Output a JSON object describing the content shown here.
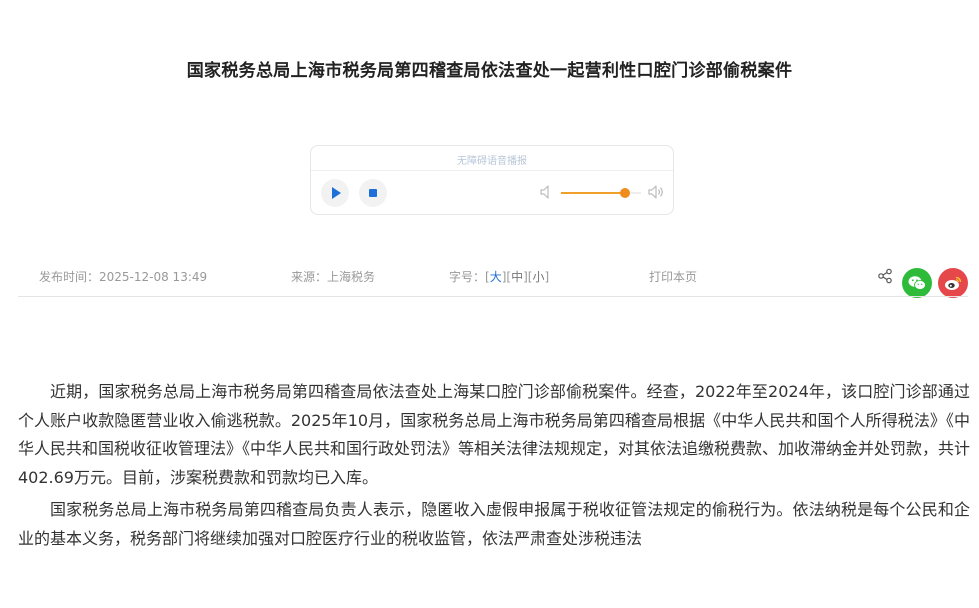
{
  "article": {
    "title": "国家税务总局上海市税务局第四稽查局依法查处一起营利性口腔门诊部偷税案件",
    "paragraphs": [
      "近期，国家税务总局上海市税务局第四稽查局依法查处上海某口腔门诊部偷税案件。经查，2022年至2024年，该口腔门诊部通过个人账户收款隐匿营业收入偷逃税款。2025年10月，国家税务总局上海市税务局第四稽查局根据《中华人民共和国个人所得税法》《中华人民共和国税收征收管理法》《中华人民共和国行政处罚法》等相关法律法规规定，对其依法追缴税费款、加收滞纳金并处罚款，共计402.69万元。目前，涉案税费款和罚款均已入库。",
      "国家税务总局上海市税务局第四稽查局负责人表示，隐匿收入虚假申报属于税收征管法规定的偷税行为。依法纳税是每个公民和企业的基本义务，税务部门将继续加强对口腔医疗行业的税收监管，依法严肃查处涉税违法"
    ]
  },
  "player": {
    "caption": "无障碍语音播报",
    "volume": 0.8
  },
  "meta": {
    "publish_label": "发布时间：2025-12-08 13:49",
    "source_label": "来源：上海税务",
    "font_size_label": "字号：",
    "bracket_open": "[",
    "bracket_close": "]",
    "size_large": "大",
    "size_medium": "中",
    "size_small": "小",
    "print_label": "打印本页"
  },
  "icons": {
    "play": "play-icon",
    "stop": "stop-icon",
    "volume_low": "volume-low-icon",
    "volume_high": "volume-high-icon",
    "share": "share-icon",
    "wechat": "wechat-icon",
    "weibo": "weibo-icon"
  },
  "colors": {
    "accent": "#1e6fd9",
    "slider": "#f08c1b",
    "wechat": "#2dbb39",
    "weibo": "#e6474b"
  }
}
